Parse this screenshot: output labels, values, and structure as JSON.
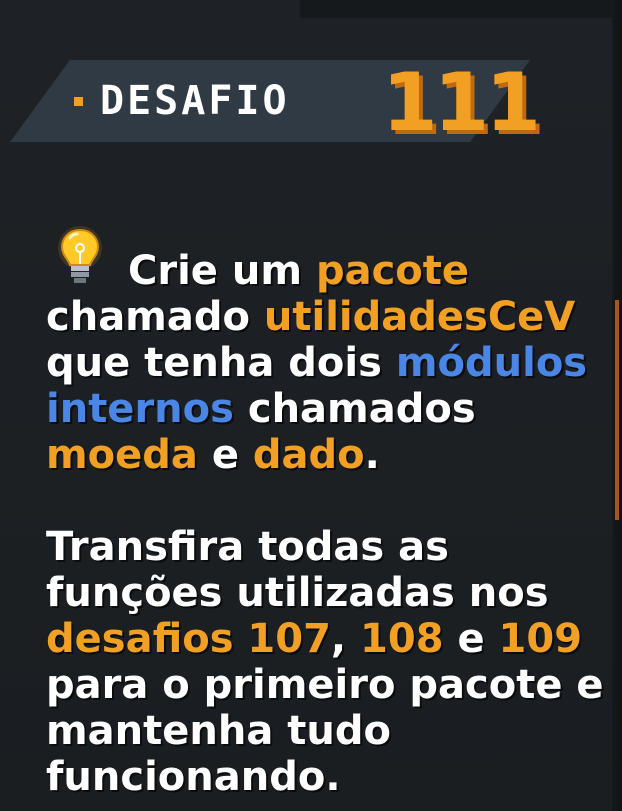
{
  "header": {
    "label": "DESAFIO",
    "number": "111"
  },
  "icons": {
    "bulb": "lightbulb-icon"
  },
  "colors": {
    "background": "#1b1f22",
    "ribbon": "#2f3a44",
    "accent_orange": "#f2a024",
    "accent_blue": "#4a86e6",
    "text": "#ffffff"
  },
  "paragraph1": {
    "l1_a": "Crie um ",
    "l1_b": "pacote",
    "l2_a": "chamado ",
    "l2_b": "utilidadesCeV",
    "l3_a": "que tenha dois ",
    "l3_b": "módulos",
    "l4_a": "internos",
    "l4_b": " chamados",
    "l5_a": "moeda",
    "l5_b": " e ",
    "l5_c": "dado",
    "l5_d": "."
  },
  "paragraph2": {
    "l1": "Transfira todas as",
    "l2": "funções utilizadas nos",
    "l3_a": "desafios 107",
    "l3_b": ", ",
    "l3_c": "108",
    "l3_d": " e ",
    "l3_e": "109",
    "l4": "para o primeiro pacote e",
    "l5": "mantenha tudo",
    "l6": "funcionando."
  }
}
